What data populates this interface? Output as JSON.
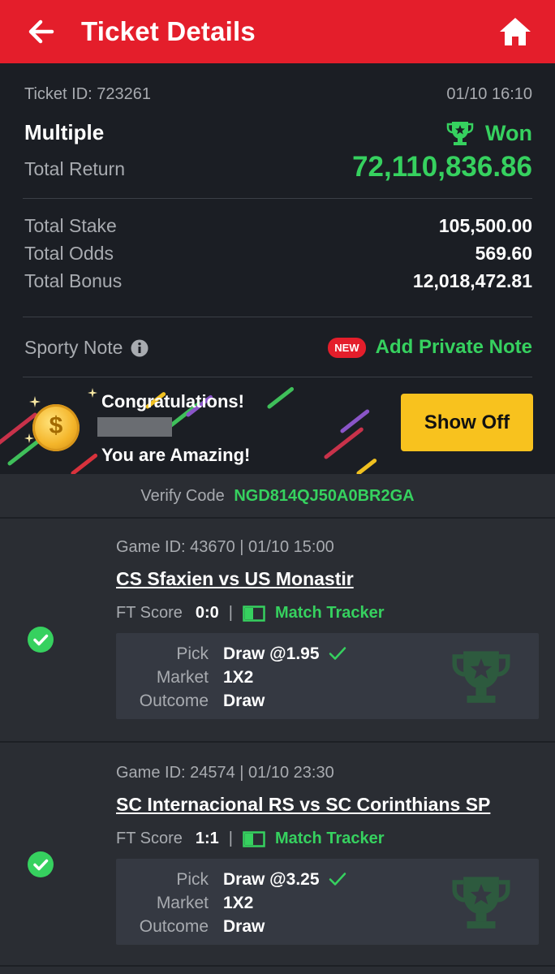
{
  "appbar": {
    "title": "Ticket Details",
    "back_icon": "arrow-left-icon",
    "home_icon": "home-icon"
  },
  "ticket": {
    "id_label": "Ticket ID: 723261",
    "datetime": "01/10 16:10",
    "type": "Multiple",
    "status": "Won",
    "total_return_label": "Total Return",
    "total_return": "72,110,836.86",
    "stake_label": "Total Stake",
    "stake": "105,500.00",
    "odds_label": "Total Odds",
    "odds": "569.60",
    "bonus_label": "Total Bonus",
    "bonus": "12,018,472.81"
  },
  "note": {
    "label": "Sporty Note",
    "new_badge": "NEW",
    "add_label": "Add Private Note"
  },
  "congrats": {
    "line1": "Congratulations!",
    "line2": "You are Amazing!",
    "button": "Show Off"
  },
  "verify": {
    "label": "Verify Code",
    "code": "NGD814QJ50A0BR2GA"
  },
  "games": [
    {
      "game_meta": "Game ID: 43670 | 01/10 15:00",
      "match": "CS Sfaxien vs US Monastir",
      "score_label": "FT Score",
      "score": "0:0",
      "tracker": "Match Tracker",
      "pick_label": "Pick",
      "pick": "Draw @1.95",
      "market_label": "Market",
      "market": "1X2",
      "outcome_label": "Outcome",
      "outcome": "Draw"
    },
    {
      "game_meta": "Game ID: 24574 | 01/10 23:30",
      "match": "SC Internacional RS vs SC Corinthians SP",
      "score_label": "FT Score",
      "score": "1:1",
      "tracker": "Match Tracker",
      "pick_label": "Pick",
      "pick": "Draw @3.25",
      "market_label": "Market",
      "market": "1X2",
      "outcome_label": "Outcome",
      "outcome": "Draw"
    }
  ],
  "colors": {
    "brand_red": "#e41e2b",
    "win_green": "#36d15f",
    "button_yellow": "#f8c21e"
  }
}
